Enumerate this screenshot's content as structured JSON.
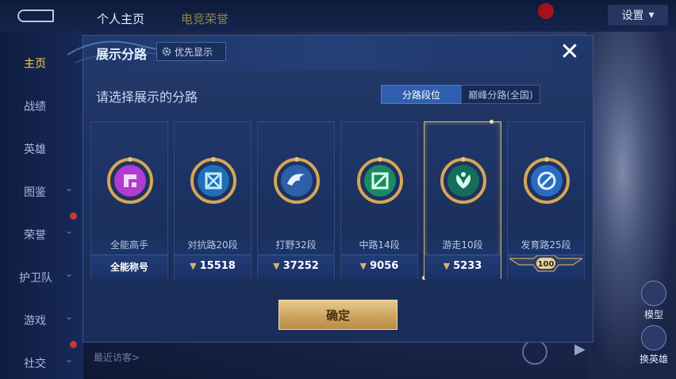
{
  "top_tabs": [
    "个人主页",
    "电竞荣誉"
  ],
  "settings_label": "设置",
  "sidebar": [
    "主页",
    "战绩",
    "英雄",
    "图鉴",
    "荣誉",
    "护卫队",
    "游戏",
    "社交"
  ],
  "right_buttons": [
    "模型",
    "换英雄"
  ],
  "visitors_label": "最近访客>",
  "modal": {
    "title": "展示分路",
    "priority_button": "优先显示",
    "close": "✕",
    "subtitle": "请选择展示的分路",
    "segments": [
      "分路段位",
      "巅峰分路(全国)"
    ],
    "cards": [
      {
        "role": "全能高手",
        "value": "全能称号",
        "icon": "all-round-emblem",
        "color": "#b13ccf"
      },
      {
        "role": "对抗路20段",
        "value": "15518",
        "icon": "clash-lane-emblem",
        "color": "#3aa0d8"
      },
      {
        "role": "打野32段",
        "value": "37252",
        "icon": "jungle-emblem",
        "color": "#2e7fd6"
      },
      {
        "role": "中路14段",
        "value": "9056",
        "icon": "mid-lane-emblem",
        "color": "#22a67a"
      },
      {
        "role": "游走10段",
        "value": "5233",
        "icon": "roam-emblem",
        "color": "#1f9f78"
      },
      {
        "role": "发育路25段",
        "value": "100",
        "icon": "farm-lane-emblem",
        "color": "#3c86d8"
      }
    ],
    "confirm": "确定"
  }
}
